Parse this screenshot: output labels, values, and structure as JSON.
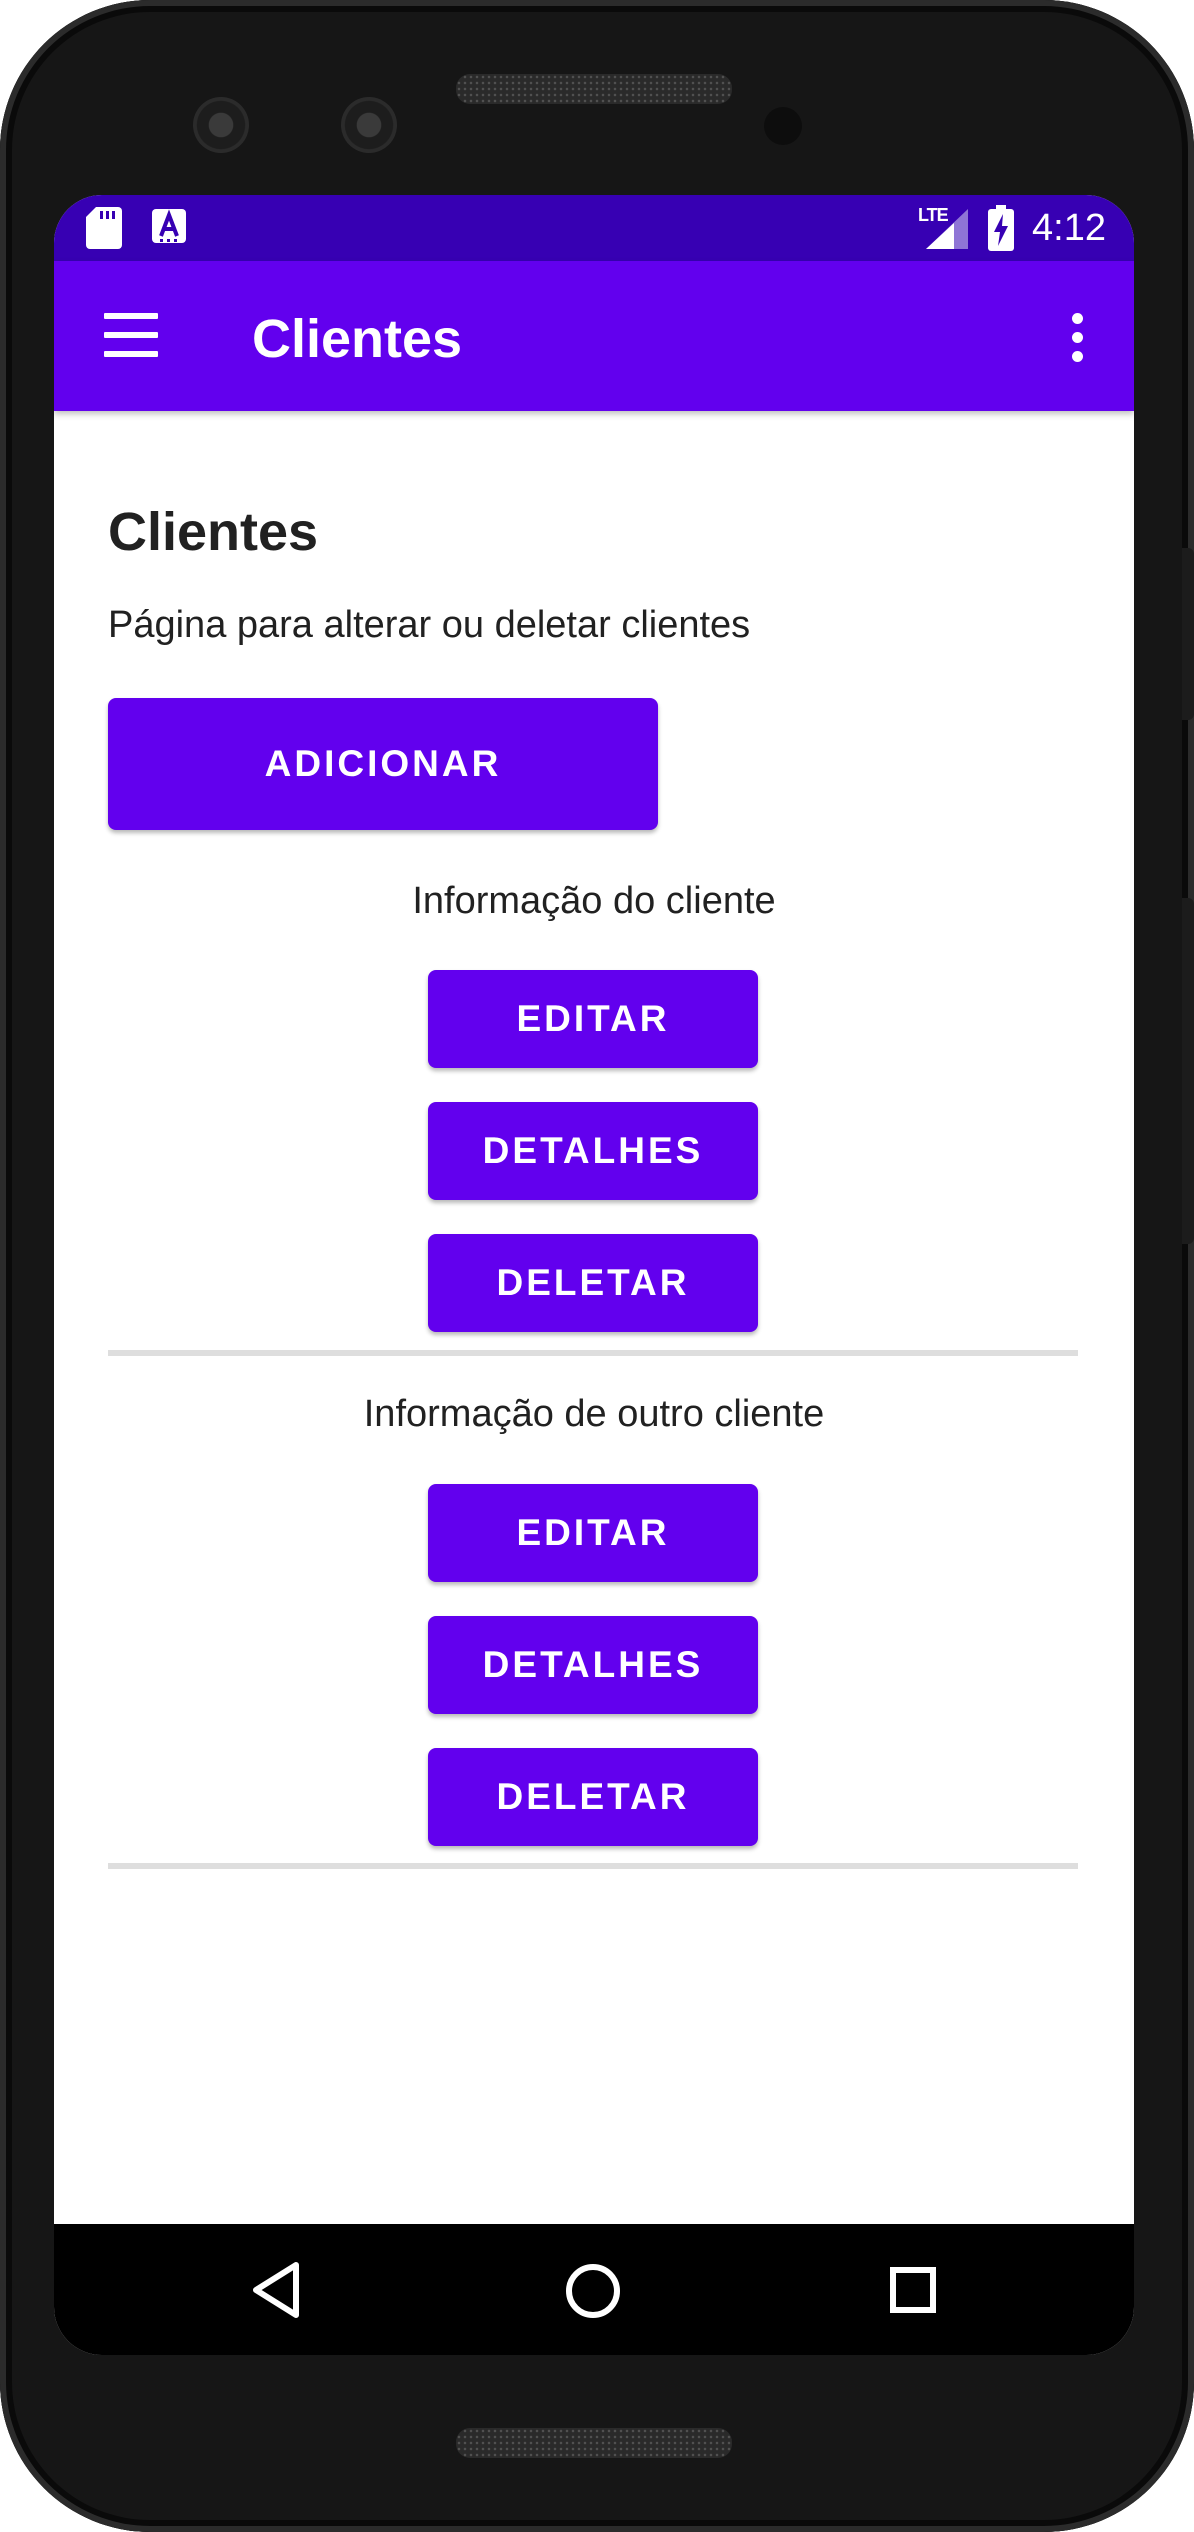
{
  "status_bar": {
    "time": "4:12",
    "network": "LTE",
    "icons": [
      "sd-card-icon",
      "app-notification-icon",
      "lte-signal-icon",
      "battery-charging-icon"
    ]
  },
  "app_bar": {
    "title": "Clientes",
    "menu_icon": "hamburger-menu-icon",
    "overflow_icon": "more-vert-icon"
  },
  "main": {
    "title": "Clientes",
    "subtitle": "Página para alterar ou deletar clientes",
    "add_label": "ADICIONAR",
    "sections": [
      {
        "caption": "Informação do cliente",
        "edit_label": "EDITAR",
        "details_label": "DETALHES",
        "delete_label": "DELETAR"
      },
      {
        "caption": "Informação de outro cliente",
        "edit_label": "EDITAR",
        "details_label": "DETALHES",
        "delete_label": "DELETAR"
      }
    ]
  },
  "nav_bar": {
    "icons": [
      "back-icon",
      "home-icon",
      "recents-icon"
    ]
  },
  "colors": {
    "primary": "#6200ee",
    "primary_dark": "#3700b3",
    "text": "#212121",
    "divider": "#dedede"
  }
}
